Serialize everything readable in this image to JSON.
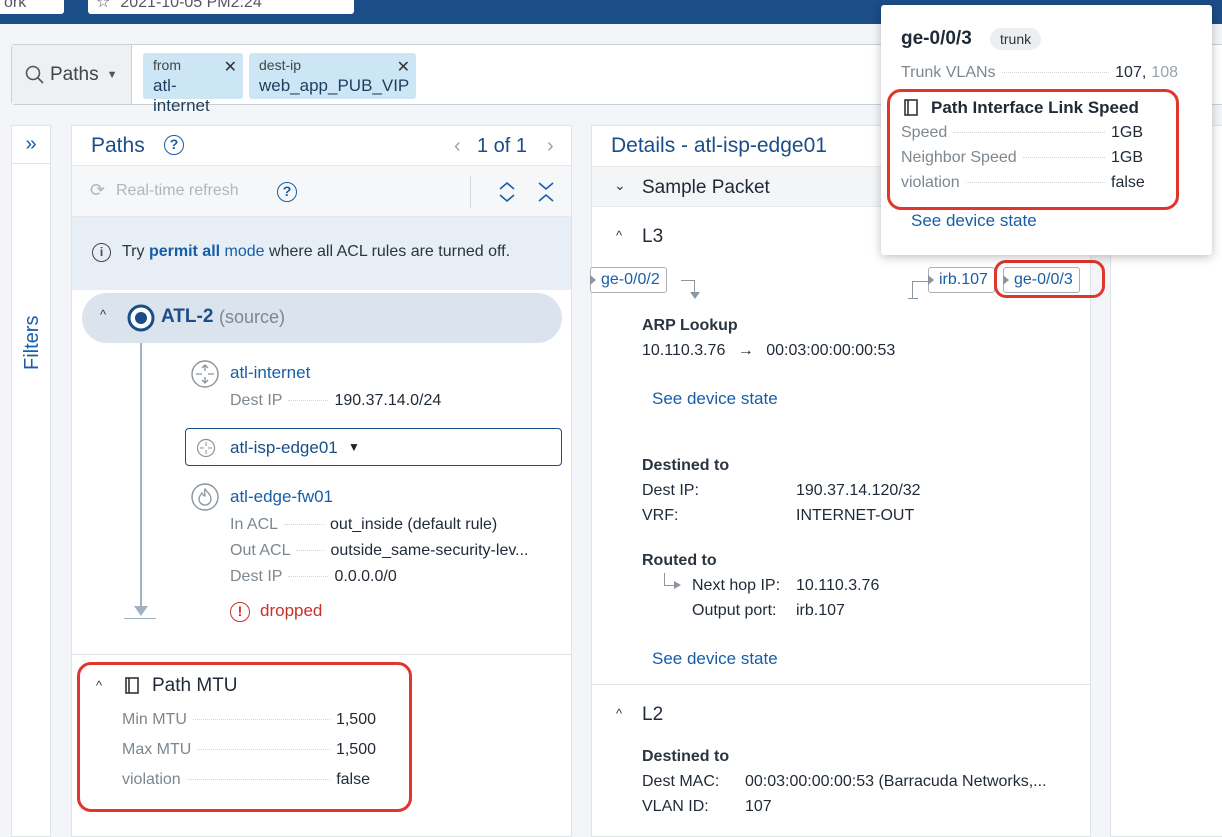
{
  "topbar": {
    "left_pill": "ork",
    "date_pill": "2021-10-05 PM2:24"
  },
  "filter": {
    "paths_label": "Paths",
    "chips": [
      {
        "key": "from",
        "value": "atl-internet"
      },
      {
        "key": "dest-ip",
        "value": "web_app_PUB_VIP"
      }
    ]
  },
  "sidebar": {
    "filters_label": "Filters",
    "expand_icon": "double-chevron-right-icon"
  },
  "paths": {
    "title": "Paths",
    "pager": "1 of 1",
    "realtime": "Real-time refresh",
    "info_pre": "Try ",
    "info_link1": "permit all",
    "info_link2": " mode",
    "info_post": " where all ACL rules are turned off.",
    "source_name": "ATL-2",
    "source_tag": "(source)",
    "hop1": {
      "name": "atl-internet",
      "dest_ip_label": "Dest IP",
      "dest_ip": "190.37.14.0/24"
    },
    "hop2": {
      "name": "atl-isp-edge01"
    },
    "hop3": {
      "name": "atl-edge-fw01",
      "in_acl_label": "In ACL",
      "in_acl": "out_inside (default rule)",
      "out_acl_label": "Out ACL",
      "out_acl": "outside_same-security-lev...",
      "dest_ip_label": "Dest IP",
      "dest_ip": "0.0.0.0/0",
      "status": "dropped"
    },
    "mtu": {
      "title": "Path MTU",
      "min_label": "Min MTU",
      "min": "1,500",
      "max_label": "Max MTU",
      "max": "1,500",
      "violation_label": "violation",
      "violation": "false"
    }
  },
  "details": {
    "title": "Details - atl-isp-edge01",
    "sample_packet": "Sample Packet",
    "l3": "L3",
    "ports": {
      "in": "ge-0/0/2",
      "irb": "irb.107",
      "out": "ge-0/0/3"
    },
    "arp_title": "ARP Lookup",
    "arp_ip": "10.110.3.76",
    "arp_arrow": "→",
    "arp_mac": "00:03:00:00:00:53",
    "see_state": "See device state",
    "destined_title": "Destined to",
    "dest_ip_label": "Dest IP:",
    "dest_ip": "190.37.14.120/32",
    "vrf_label": "VRF:",
    "vrf": "INTERNET-OUT",
    "routed_title": "Routed to",
    "next_hop_label": "Next hop IP:",
    "next_hop": "10.110.3.76",
    "output_port_label": "Output port:",
    "output_port": "irb.107",
    "see_state2": "See device state",
    "l2": "L2",
    "l2_destined": "Destined to",
    "dest_mac_label": "Dest MAC:",
    "dest_mac": "00:03:00:00:00:53 (Barracuda Networks,...",
    "vlan_label": "VLAN ID:",
    "vlan": "107"
  },
  "tooltip": {
    "title": "ge-0/0/3",
    "badge": "trunk",
    "trunk_label": "Trunk VLANs",
    "trunk_val1": "107,",
    "trunk_val2": "108",
    "speed_title": "Path Interface Link Speed",
    "speed_label": "Speed",
    "speed": "1GB",
    "neighbor_label": "Neighbor Speed",
    "neighbor": "1GB",
    "violation_label": "violation",
    "violation": "false",
    "see_state": "See device state"
  },
  "colors": {
    "accent": "#175ea8",
    "highlight": "#e0362c",
    "dropped": "#c8302a",
    "chip": "#cde6f6"
  }
}
